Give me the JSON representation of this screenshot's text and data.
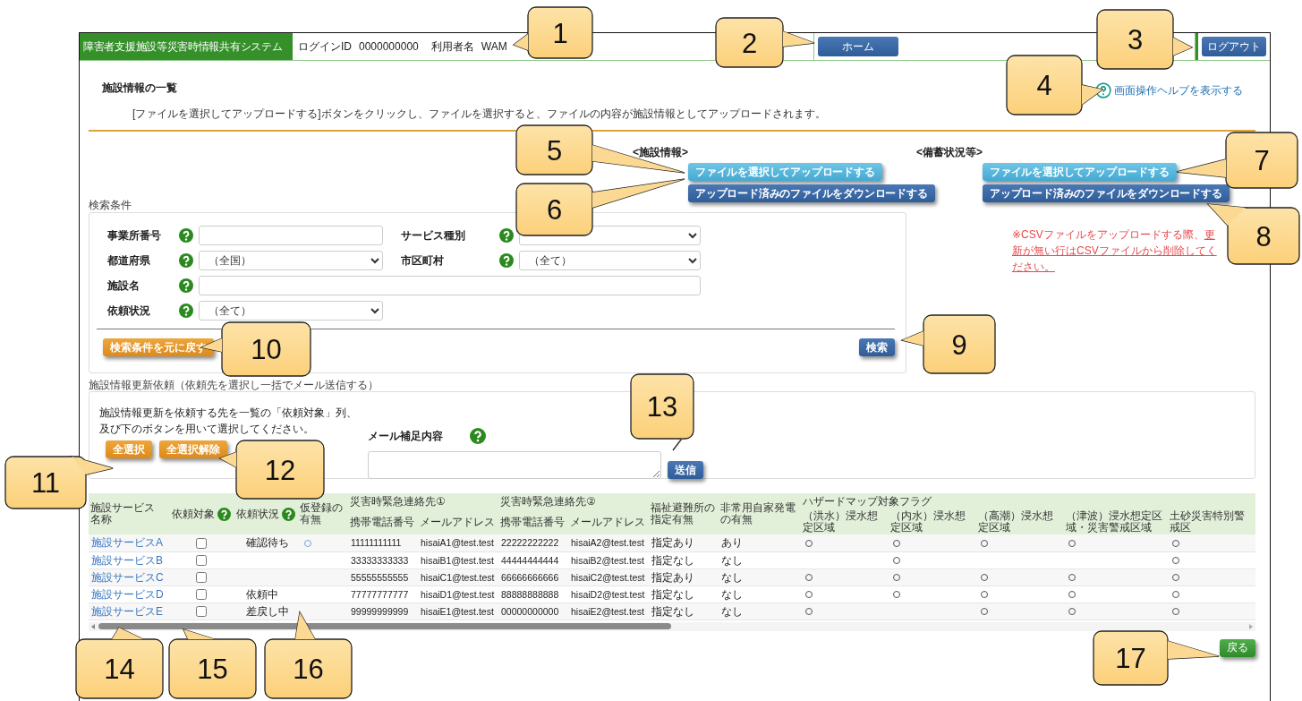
{
  "header": {
    "system_name": "障害者支援施設等災害時情報共有システム",
    "login_label": "ログインID",
    "login_id": "0000000000",
    "user_label": "利用者名",
    "user_name": "WAM",
    "home_button": "ホーム",
    "logout_button": "ログアウト"
  },
  "page": {
    "title": "施設情報の一覧",
    "help_link": "画面操作ヘルプを表示する",
    "instruction": "[ファイルを選択してアップロードする]ボタンをクリックし、ファイルを選択すると、ファイルの内容が施設情報としてアップロードされます。"
  },
  "upload_sections": [
    {
      "heading": "<施設情報>",
      "upload_button": "ファイルを選択してアップロードする",
      "download_button": "アップロード済みのファイルをダウンロードする"
    },
    {
      "heading": "<備蓄状況等>",
      "upload_button": "ファイルを選択してアップロードする",
      "download_button": "アップロード済みのファイルをダウンロードする",
      "note": "※CSVファイルをアップロードする際、",
      "note_link": "更新が無い行はCSVファイルから削除してください。"
    }
  ],
  "search": {
    "legend": "検索条件",
    "fields": [
      {
        "label": "事業所番号",
        "kind": "text"
      },
      {
        "label": "サービス種別",
        "kind": "select"
      },
      {
        "label": "都道府県",
        "kind": "select",
        "value": "（全国）"
      },
      {
        "label": "市区町村",
        "kind": "select",
        "value": "（全て）"
      },
      {
        "label": "施設名",
        "kind": "wide_text"
      },
      {
        "label": "依頼状況",
        "kind": "select",
        "value": "（全て）"
      }
    ],
    "reset_button": "検索条件を元に戻す",
    "search_button": "検索"
  },
  "request": {
    "legend": "施設情報更新依頼（依頼先を選択し一括でメール送信する）",
    "instruction": "施設情報更新を依頼する先を一覧の「依頼対象」列、及び下のボタンを用いて選択してください。",
    "select_all_button": "全選択",
    "deselect_all_button": "全選択解除",
    "mail_label": "メール補足内容",
    "send_button": "送信"
  },
  "table": {
    "columns": [
      {
        "label": "施設サービス名称",
        "help": false
      },
      {
        "label": "依頼対象",
        "help": true
      },
      {
        "label": "依頼状況",
        "help": true
      },
      {
        "label": "仮登録の有無",
        "help": false
      },
      {
        "label": "災害時緊急連絡先①",
        "children": [
          {
            "label": "携帯電話番号"
          },
          {
            "label": "メールアドレス"
          }
        ]
      },
      {
        "label": "災害時緊急連絡先②",
        "children": [
          {
            "label": "携帯電話番号"
          },
          {
            "label": "メールアドレス"
          }
        ]
      },
      {
        "label": "福祉避難所の指定有無",
        "help": false
      },
      {
        "label": "非常用自家発電の有無",
        "help": false
      },
      {
        "label": "ハザードマップ対象フラグ",
        "children": [
          {
            "label": "（洪水）浸水想定区域"
          },
          {
            "label": "（内水）浸水想定区域"
          },
          {
            "label": "（高潮）浸水想定区域"
          },
          {
            "label": "（津波）浸水想定区域・災害警戒区域"
          },
          {
            "label": "土砂災害特別警戒区"
          }
        ]
      }
    ],
    "rows": [
      {
        "name": "施設サービスA",
        "target_checked": false,
        "status": "確認待ち",
        "provisional": true,
        "phone1": "11111111111",
        "email1": "hisaiA1@test.test",
        "phone2": "22222222222",
        "email2": "hisaiA2@test.test",
        "shelter": "指定あり",
        "generator": "あり",
        "hazard_flags": [
          true,
          true,
          true,
          true,
          true
        ]
      },
      {
        "name": "施設サービスB",
        "target_checked": false,
        "provisional": false,
        "phone1": "33333333333",
        "email1": "hisaiB1@test.test",
        "phone2": "44444444444",
        "email2": "hisaiB2@test.test",
        "shelter": "指定なし",
        "generator": "なし",
        "hazard_flags": [
          false,
          true,
          false,
          false,
          true
        ]
      },
      {
        "name": "施設サービスC",
        "target_checked": false,
        "provisional": false,
        "phone1": "55555555555",
        "email1": "hisaiC1@test.test",
        "phone2": "66666666666",
        "email2": "hisaiC2@test.test",
        "shelter": "指定あり",
        "generator": "なし",
        "hazard_flags": [
          true,
          true,
          true,
          true,
          true
        ]
      },
      {
        "name": "施設サービスD",
        "target_checked": false,
        "status": "依頼中",
        "provisional": false,
        "phone1": "77777777777",
        "email1": "hisaiD1@test.test",
        "phone2": "88888888888",
        "email2": "hisaiD2@test.test",
        "shelter": "指定なし",
        "generator": "なし",
        "hazard_flags": [
          true,
          true,
          true,
          true,
          true
        ]
      },
      {
        "name": "施設サービスE",
        "target_checked": false,
        "status": "差戻し中",
        "provisional": false,
        "phone1": "99999999999",
        "email1": "hisaiE1@test.test",
        "phone2": "00000000000",
        "email2": "hisaiE2@test.test",
        "shelter": "指定なし",
        "generator": "なし",
        "hazard_flags": [
          true,
          false,
          true,
          true,
          true
        ]
      }
    ]
  },
  "back_button": "戻る",
  "callouts": [
    "1",
    "2",
    "3",
    "4",
    "5",
    "6",
    "7",
    "8",
    "9",
    "10",
    "11",
    "12",
    "13",
    "14",
    "15",
    "16",
    "17"
  ]
}
